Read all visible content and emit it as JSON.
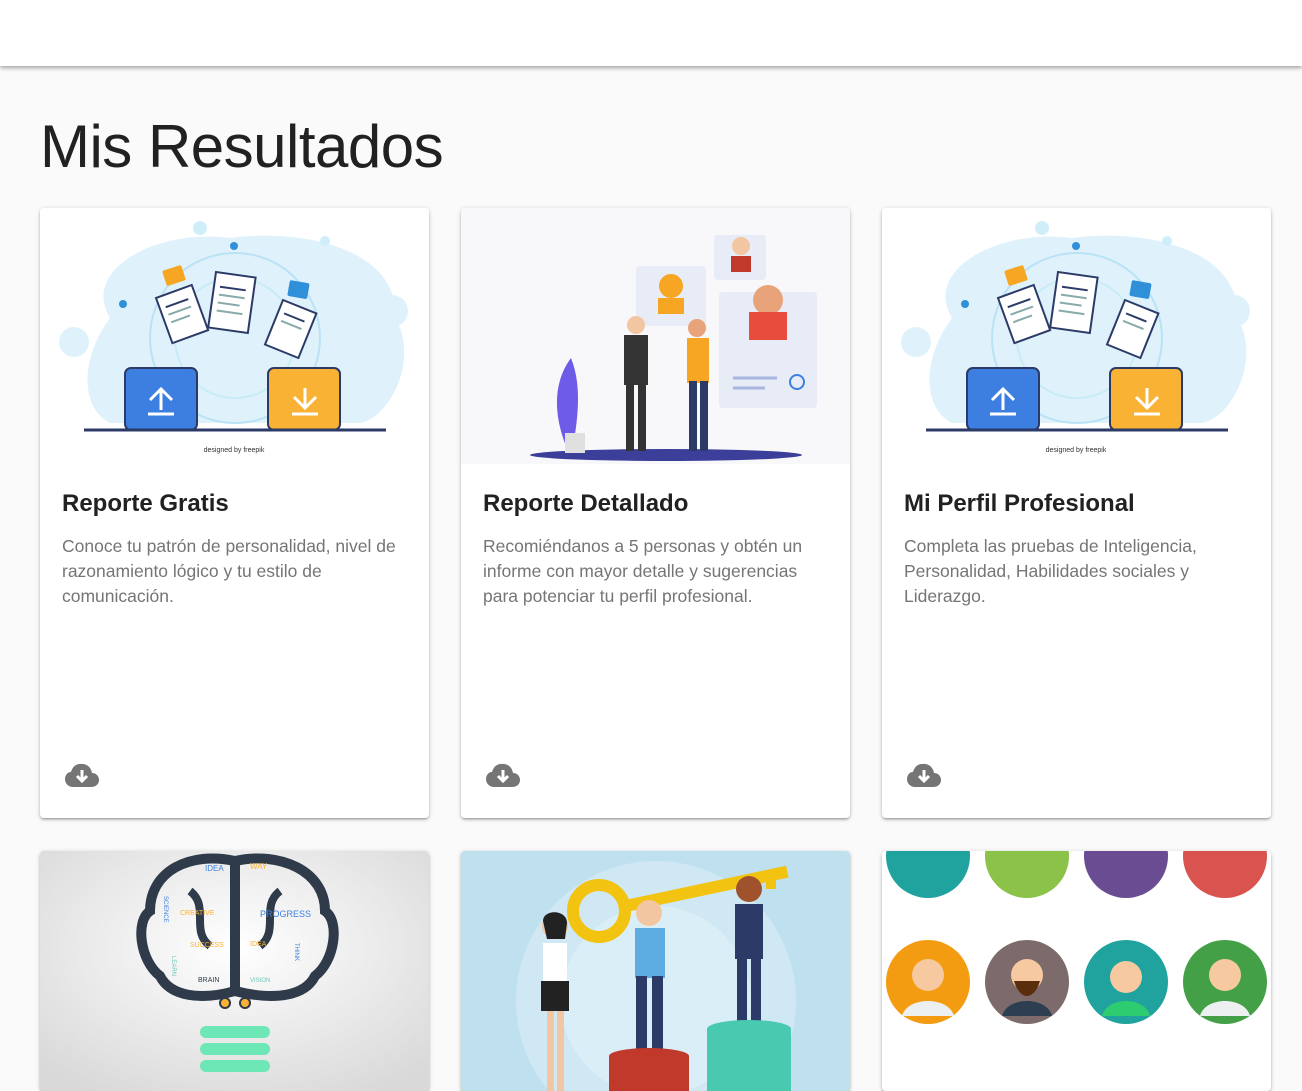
{
  "page": {
    "title": "Mis Resultados"
  },
  "cards": [
    {
      "title": "Reporte Gratis",
      "description": "Conoce tu patrón de personalidad, nivel de razonamiento lógico y tu estilo de comunicación.",
      "credit": "designed by freepik",
      "action_icon": "cloud-download-icon"
    },
    {
      "title": "Reporte Detallado",
      "description": "Recomiéndanos a 5 personas y obtén un informe con mayor detalle y sugerencias para potenciar tu perfil profesional.",
      "action_icon": "cloud-download-icon"
    },
    {
      "title": "Mi Perfil Profesional",
      "description": "Completa las pruebas de Inteligencia, Personalidad, Habilidades sociales y Liderazgo.",
      "credit": "designed by freepik",
      "action_icon": "cloud-download-icon"
    }
  ],
  "lower_cards": [
    {
      "words": [
        "IDEA",
        "WAY",
        "SCIENCE",
        "CREATIVE",
        "PROGRESS",
        "SUCCESS",
        "IDEA",
        "THINK",
        "LEARN",
        "BRAIN",
        "VISION"
      ]
    },
    {},
    {}
  ],
  "colors": {
    "accent_blue": "#3d7fe0",
    "folder_orange": "#f9b233",
    "icon_grey": "#757575",
    "text_secondary": "#757575"
  }
}
